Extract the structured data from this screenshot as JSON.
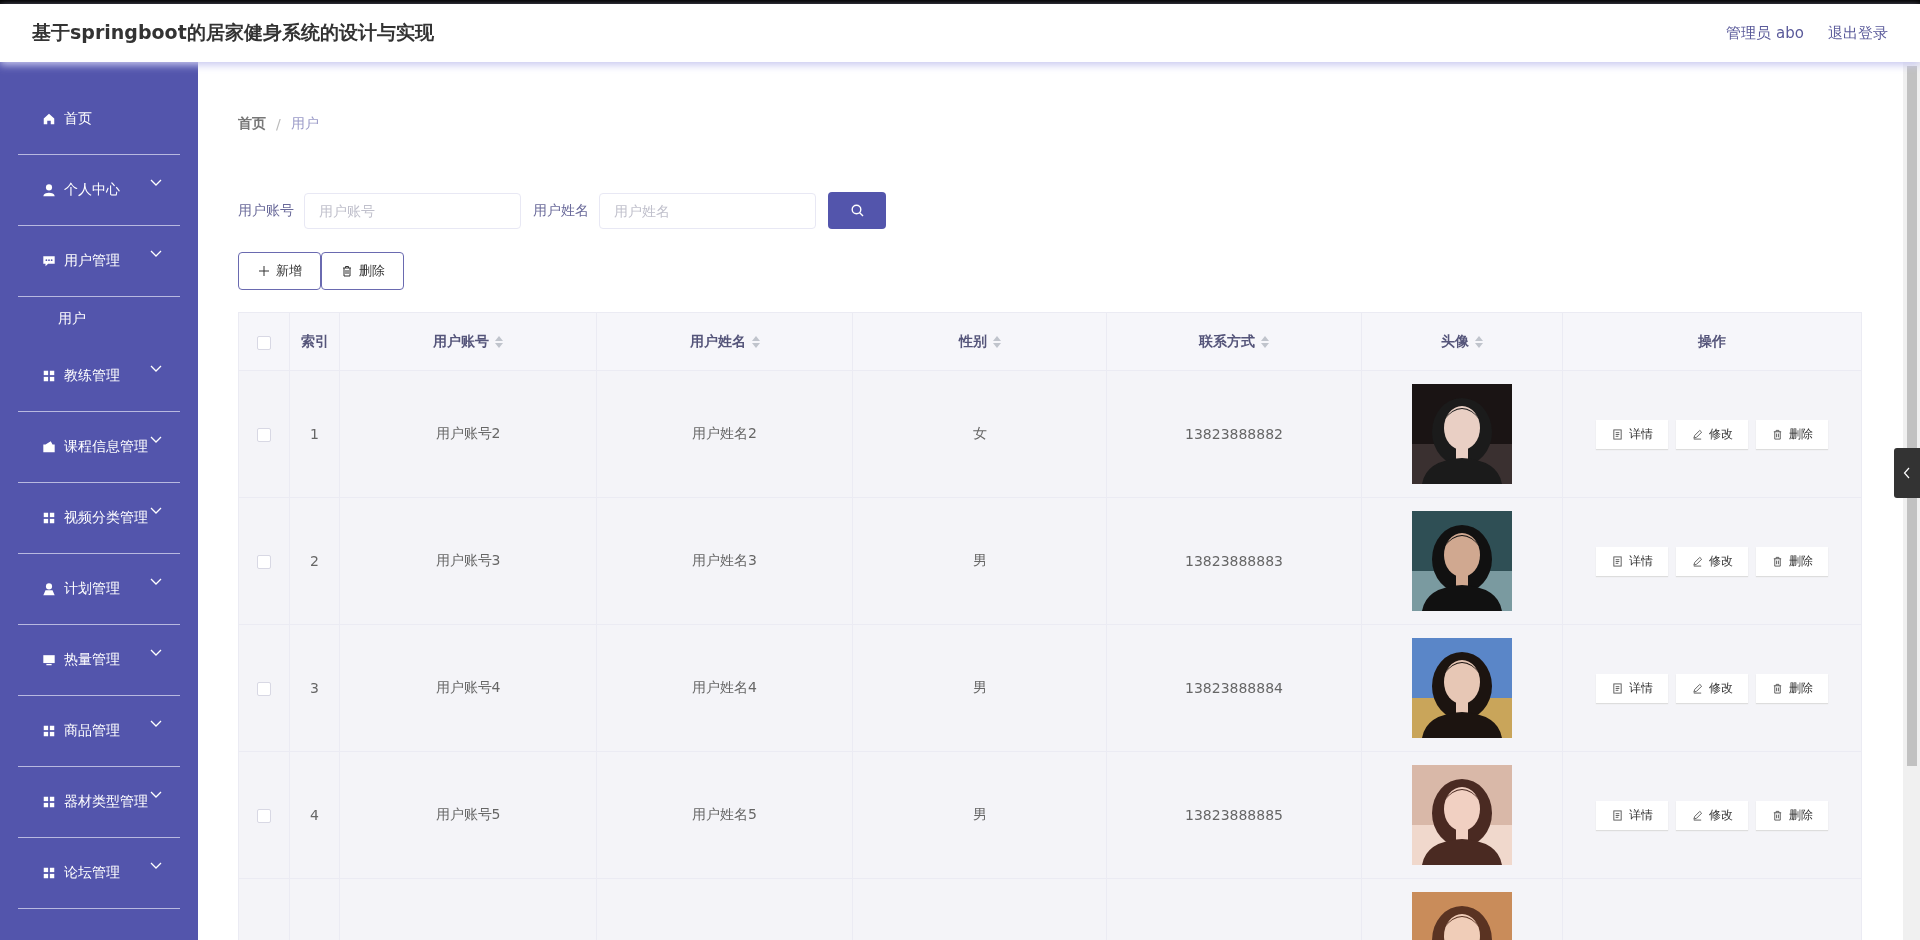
{
  "header": {
    "title": "基于springboot的居家健身系统的设计与实现",
    "user": "管理员 abo",
    "logout": "退出登录"
  },
  "sidebar": {
    "items": [
      {
        "label": "首页",
        "kind": "link"
      },
      {
        "label": "个人中心",
        "kind": "menu"
      },
      {
        "label": "用户管理",
        "kind": "menu",
        "children": [
          {
            "label": "用户"
          }
        ]
      },
      {
        "label": "教练管理",
        "kind": "menu"
      },
      {
        "label": "课程信息管理",
        "kind": "menu"
      },
      {
        "label": "视频分类管理",
        "kind": "menu"
      },
      {
        "label": "计划管理",
        "kind": "menu"
      },
      {
        "label": "热量管理",
        "kind": "menu"
      },
      {
        "label": "商品管理",
        "kind": "menu"
      },
      {
        "label": "器材类型管理",
        "kind": "menu"
      },
      {
        "label": "论坛管理",
        "kind": "menu"
      }
    ]
  },
  "breadcrumb": {
    "items": [
      "首页",
      "用户"
    ],
    "separator": "/"
  },
  "search": {
    "fields": [
      {
        "label": "用户账号",
        "placeholder": "用户账号"
      },
      {
        "label": "用户姓名",
        "placeholder": "用户姓名"
      }
    ]
  },
  "actions": [
    {
      "label": "新增",
      "kind": "add"
    },
    {
      "label": "删除",
      "kind": "delete"
    }
  ],
  "table": {
    "columns": [
      {
        "kind": "checkbox",
        "checked": false
      },
      {
        "kind": "text",
        "label": "索引",
        "sortable": false
      },
      {
        "kind": "text",
        "label": "用户账号",
        "sortable": true
      },
      {
        "kind": "text",
        "label": "用户姓名",
        "sortable": true
      },
      {
        "kind": "text",
        "label": "性别",
        "sortable": true
      },
      {
        "kind": "text",
        "label": "联系方式",
        "sortable": true
      },
      {
        "kind": "text",
        "label": "头像",
        "sortable": true
      },
      {
        "kind": "text",
        "label": "操作",
        "sortable": false
      }
    ],
    "rows": [
      {
        "checked": false,
        "index": "1",
        "account": "用户账号2",
        "name": "用户姓名2",
        "gender": "女",
        "phone": "13823888882",
        "avatar": {
          "kind": "picture"
        },
        "actions": [
          "详情",
          "修改",
          "删除"
        ]
      },
      {
        "checked": false,
        "index": "2",
        "account": "用户账号3",
        "name": "用户姓名3",
        "gender": "男",
        "phone": "13823888883",
        "avatar": {
          "kind": "picture"
        },
        "actions": [
          "详情",
          "修改",
          "删除"
        ]
      },
      {
        "checked": false,
        "index": "3",
        "account": "用户账号4",
        "name": "用户姓名4",
        "gender": "男",
        "phone": "13823888884",
        "avatar": {
          "kind": "picture"
        },
        "actions": [
          "详情",
          "修改",
          "删除"
        ]
      },
      {
        "checked": false,
        "index": "4",
        "account": "用户账号5",
        "name": "用户姓名5",
        "gender": "男",
        "phone": "13823888885",
        "avatar": {
          "kind": "picture"
        },
        "actions": [
          "详情",
          "修改",
          "删除"
        ]
      },
      {
        "avatar": {
          "kind": "picture"
        }
      }
    ]
  }
}
